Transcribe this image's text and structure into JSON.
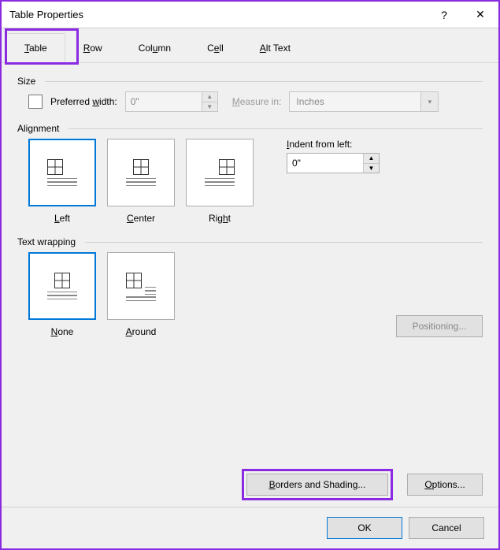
{
  "window": {
    "title": "Table Properties",
    "help": "?",
    "close": "✕"
  },
  "tabs": {
    "table": "Table",
    "row": "Row",
    "column": "Column",
    "cell": "Cell",
    "altText": "Alt Text"
  },
  "size": {
    "group": "Size",
    "preferredWidth": "Preferred width:",
    "widthValue": "0\"",
    "measureIn": "Measure in:",
    "measureUnit": "Inches"
  },
  "alignment": {
    "group": "Alignment",
    "left": "Left",
    "center": "Center",
    "right": "Right",
    "indentLabel": "Indent from left:",
    "indentValue": "0\""
  },
  "wrap": {
    "group": "Text wrapping",
    "none": "None",
    "around": "Around",
    "positioning": "Positioning..."
  },
  "footer": {
    "bordersShading": "Borders and Shading...",
    "options": "Options..."
  },
  "buttons": {
    "ok": "OK",
    "cancel": "Cancel"
  }
}
